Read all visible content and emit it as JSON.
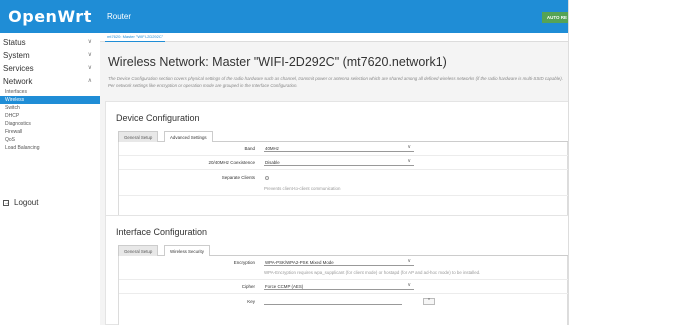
{
  "brand": {
    "logo": "OpenWrt"
  },
  "header": {
    "title": "Router",
    "auto_refresh": "AUTO RE"
  },
  "sidebar": {
    "items": [
      {
        "label": "Status"
      },
      {
        "label": "System"
      },
      {
        "label": "Services"
      },
      {
        "label": "Network"
      }
    ],
    "network_sub": [
      "Interfaces",
      "Wireless",
      "Switch",
      "DHCP",
      "Diagnostics",
      "Firewall",
      "QoS",
      "Load Balancing"
    ],
    "logout": "Logout"
  },
  "breadcrumb": "mt7620: Master \"WIFI-2D292C\"",
  "page": {
    "title": "Wireless Network: Master \"WIFI-2D292C\" (mt7620.network1)",
    "desc_a": "The Device Configuration section covers physical settings of the radio hardware such as channel, transmit power or antenna selection which are shared among all defined wireless",
    "desc_b": "networks (if the radio hardware is multi-SSID capable). Per network settings like encryption or operation mode are grouped in the",
    "desc_em": "Interface Configuration."
  },
  "device": {
    "title": "Device Configuration",
    "tabs": [
      "General Setup",
      "Advanced Settings"
    ],
    "band_label": "Band",
    "band_value": "40MHz",
    "coex_label": "20/40MHz Coexistence",
    "coex_value": "Disable",
    "sep_label": "Separate Clients",
    "sep_hint": "Prevents client-to-client communication"
  },
  "iface": {
    "title": "Interface Configuration",
    "tabs": [
      "General Setup",
      "Wireless Security"
    ],
    "enc_label": "Encryption",
    "enc_value": "WPA-PSK/WPA2-PSK Mixed Mode",
    "enc_hint": "WPA-Encryption requires wpa_supplicant (for client mode) or hostapd (for AP and ad-hoc mode) to be installed.",
    "cipher_label": "Cipher",
    "cipher_value": "Force CCMP (AES)",
    "key_label": "Key",
    "key_btn": "*"
  },
  "icons": {
    "chevron": "chevron-down-icon",
    "logout": "logout-icon",
    "reveal": "reveal-icon"
  },
  "colors": {
    "accent": "#1f8dd6",
    "refresh": "#55a355"
  }
}
